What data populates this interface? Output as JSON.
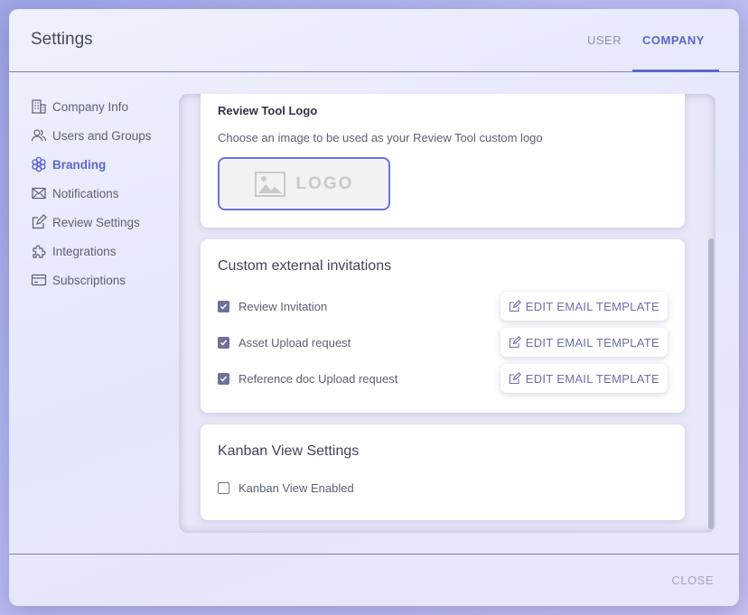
{
  "header": {
    "title": "Settings",
    "tabs": [
      {
        "label": "USER",
        "active": false
      },
      {
        "label": "COMPANY",
        "active": true
      }
    ]
  },
  "sidebar": {
    "items": [
      {
        "label": "Company Info",
        "icon": "building-icon"
      },
      {
        "label": "Users and Groups",
        "icon": "users-icon"
      },
      {
        "label": "Branding",
        "icon": "flower-icon",
        "active": true
      },
      {
        "label": "Notifications",
        "icon": "envelope-icon"
      },
      {
        "label": "Review Settings",
        "icon": "edit-icon"
      },
      {
        "label": "Integrations",
        "icon": "puzzle-icon"
      },
      {
        "label": "Subscriptions",
        "icon": "card-icon"
      }
    ]
  },
  "branding": {
    "logo_heading": "Review Tool Logo",
    "logo_description": "Choose an image to be used as your Review Tool custom logo",
    "logo_placeholder": "LOGO"
  },
  "invitations": {
    "heading": "Custom external invitations",
    "edit_label": "EDIT EMAIL TEMPLATE",
    "items": [
      {
        "label": "Review Invitation",
        "checked": true
      },
      {
        "label": "Asset Upload request",
        "checked": true
      },
      {
        "label": "Reference doc Upload request",
        "checked": true
      }
    ]
  },
  "kanban": {
    "heading": "Kanban View Settings",
    "option_label": "Kanban View Enabled",
    "checked": false
  },
  "footer": {
    "close_label": "CLOSE"
  },
  "colors": {
    "accent": "#5c66cf",
    "text": "#5b6077",
    "checkbox": "#6d7299"
  }
}
